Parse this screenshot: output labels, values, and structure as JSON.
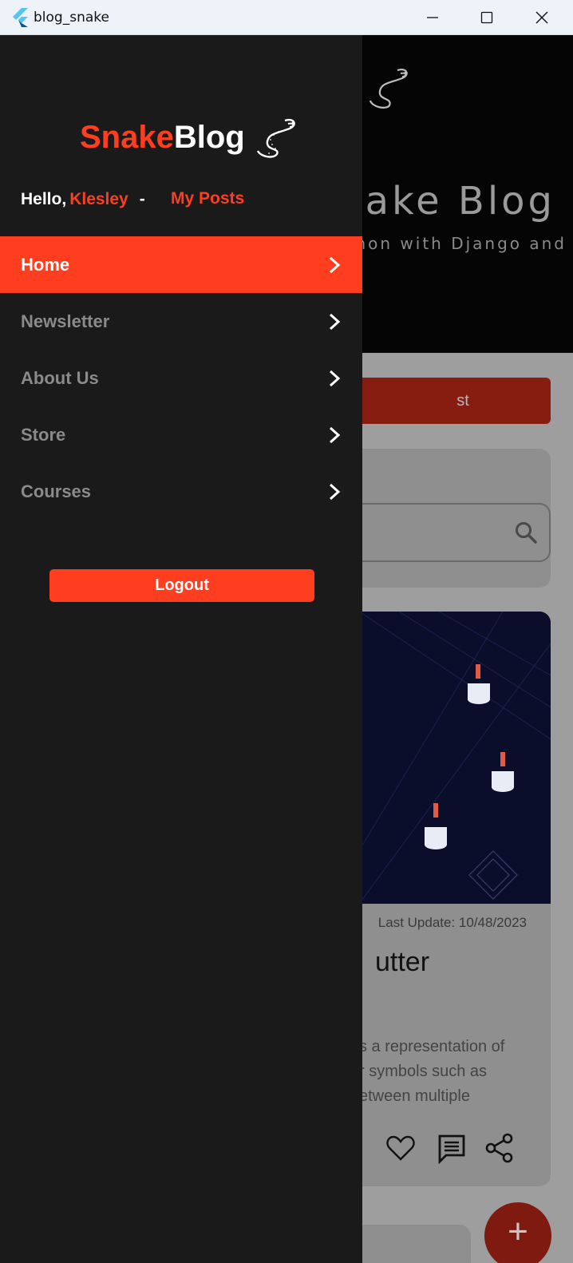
{
  "window": {
    "title": "blog_snake"
  },
  "hero": {
    "title": "ake Blog",
    "subtitle_line1": "hon with Django and",
    "subtitle_line2": "!"
  },
  "main": {
    "new_post_label": "st",
    "post": {
      "meta": "Last Update: 10/48/2023",
      "title": "utter",
      "excerpt_line1": "s a representation of",
      "excerpt_line2": "r symbols such as",
      "excerpt_line3": "etween multiple"
    },
    "fab_label": "+"
  },
  "drawer": {
    "brand_part1": "Snake",
    "brand_part2": "Blog",
    "greeting": "Hello,",
    "user_name": "Klesley",
    "separator": "-",
    "my_posts": "My Posts",
    "menu": [
      {
        "label": "Home"
      },
      {
        "label": "Newsletter"
      },
      {
        "label": "About Us"
      },
      {
        "label": "Store"
      },
      {
        "label": "Courses"
      }
    ],
    "logout_label": "Logout"
  },
  "colors": {
    "accent": "#ff3d1f",
    "drawer_bg": "#1a1a1a"
  }
}
